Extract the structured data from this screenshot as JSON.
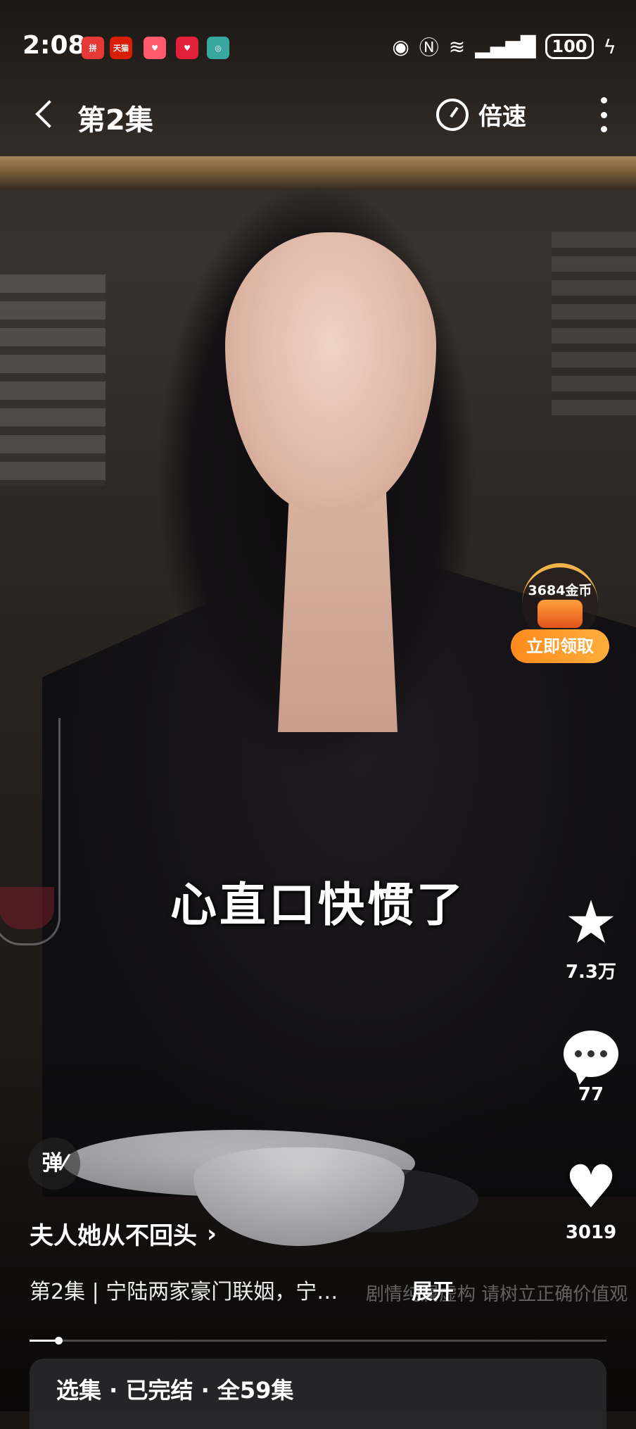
{
  "status_bar": {
    "time": "2:08",
    "battery": "100",
    "notification_apps": [
      "拼多多",
      "天猫",
      "小红书",
      "心动",
      "健康"
    ]
  },
  "nav": {
    "episode_title": "第2集",
    "speed_label": "倍速"
  },
  "reward": {
    "coins": "3684金币",
    "claim_label": "立即领取"
  },
  "video": {
    "subtitle": "心直口快惯了",
    "disclaimer": "剧情纯属虚构 请树立正确价值观"
  },
  "actions": {
    "favorite_count": "7.3万",
    "comment_count": "77",
    "like_count": "3019"
  },
  "danmaku": {
    "label": "弹"
  },
  "drama": {
    "title": "夫人她从不回头",
    "description": "第2集 | 宁陆两家豪门联姻，宁…",
    "expand_label": "展开",
    "progress": 0.05
  },
  "episode_bar": {
    "text": "选集 · 已完结 · 全59集"
  },
  "colors": {
    "accent": "#ff9a2a",
    "overlay": "#28282a"
  }
}
